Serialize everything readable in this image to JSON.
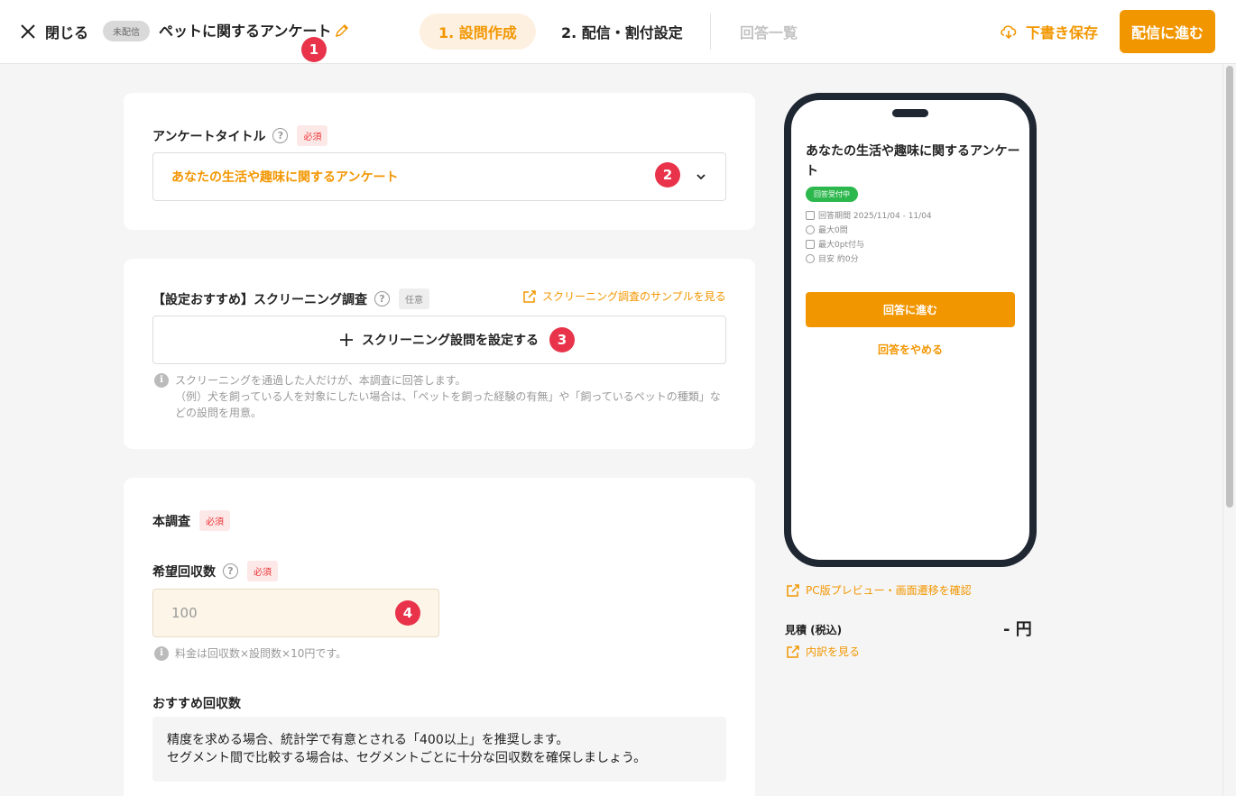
{
  "header": {
    "close_label": "閉じる",
    "status_badge": "未配信",
    "survey_name": "ペットに関するアンケート",
    "tabs": [
      {
        "label": "1. 設問作成"
      },
      {
        "label": "2. 配信・割付設定"
      },
      {
        "label": "回答一覧"
      }
    ],
    "save_draft_label": "下書き保存",
    "proceed_label": "配信に進む"
  },
  "markers": [
    "1",
    "2",
    "3",
    "4"
  ],
  "title_section": {
    "label": "アンケートタイトル",
    "required_tag": "必須",
    "value": "あなたの生活や趣味に関するアンケート"
  },
  "screening_section": {
    "label": "【設定おすすめ】スクリーニング調査",
    "optional_tag": "任意",
    "sample_link": "スクリーニング調査のサンプルを見る",
    "add_button": "スクリーニング設問を設定する",
    "info_line1": "スクリーニングを通過した人だけが、本調査に回答します。",
    "info_line2": "（例）犬を飼っている人を対象にしたい場合は、「ペットを飼った経験の有無」や「飼っているペットの種類」な",
    "info_line3": "どの設問を用意。"
  },
  "main_section": {
    "label": "本調査",
    "required_tag": "必須",
    "count_label": "希望回収数",
    "count_required_tag": "必須",
    "count_placeholder": "100",
    "pricing_info": "料金は回収数×設問数×10円です。",
    "recommend_label": "おすすめ回収数",
    "recommend_line1": "精度を求める場合、統計学で有意とされる「400以上」を推奨します。",
    "recommend_line2": "セグメント間で比較する場合は、セグメントごとに十分な回収数を確保しましょう。"
  },
  "preview": {
    "title": "あなたの生活や趣味に関するアンケート",
    "status": "回答受付中",
    "period": "回答期間 2025/11/04 - 11/04",
    "max_questions": "最大0問",
    "max_points": "最大0pt付与",
    "time_estimate": "目安 約0分",
    "answer_button": "回答に進む",
    "stop_button": "回答をやめる",
    "pc_preview_link": "PC版プレビュー・画面遷移を確認",
    "estimate_label": "見積 (税込)",
    "estimate_value": "- 円",
    "breakdown_link": "内訳を見る"
  },
  "colors": {
    "accent": "#f29600",
    "marker": "#e8334a",
    "status_green": "#2db84d"
  }
}
